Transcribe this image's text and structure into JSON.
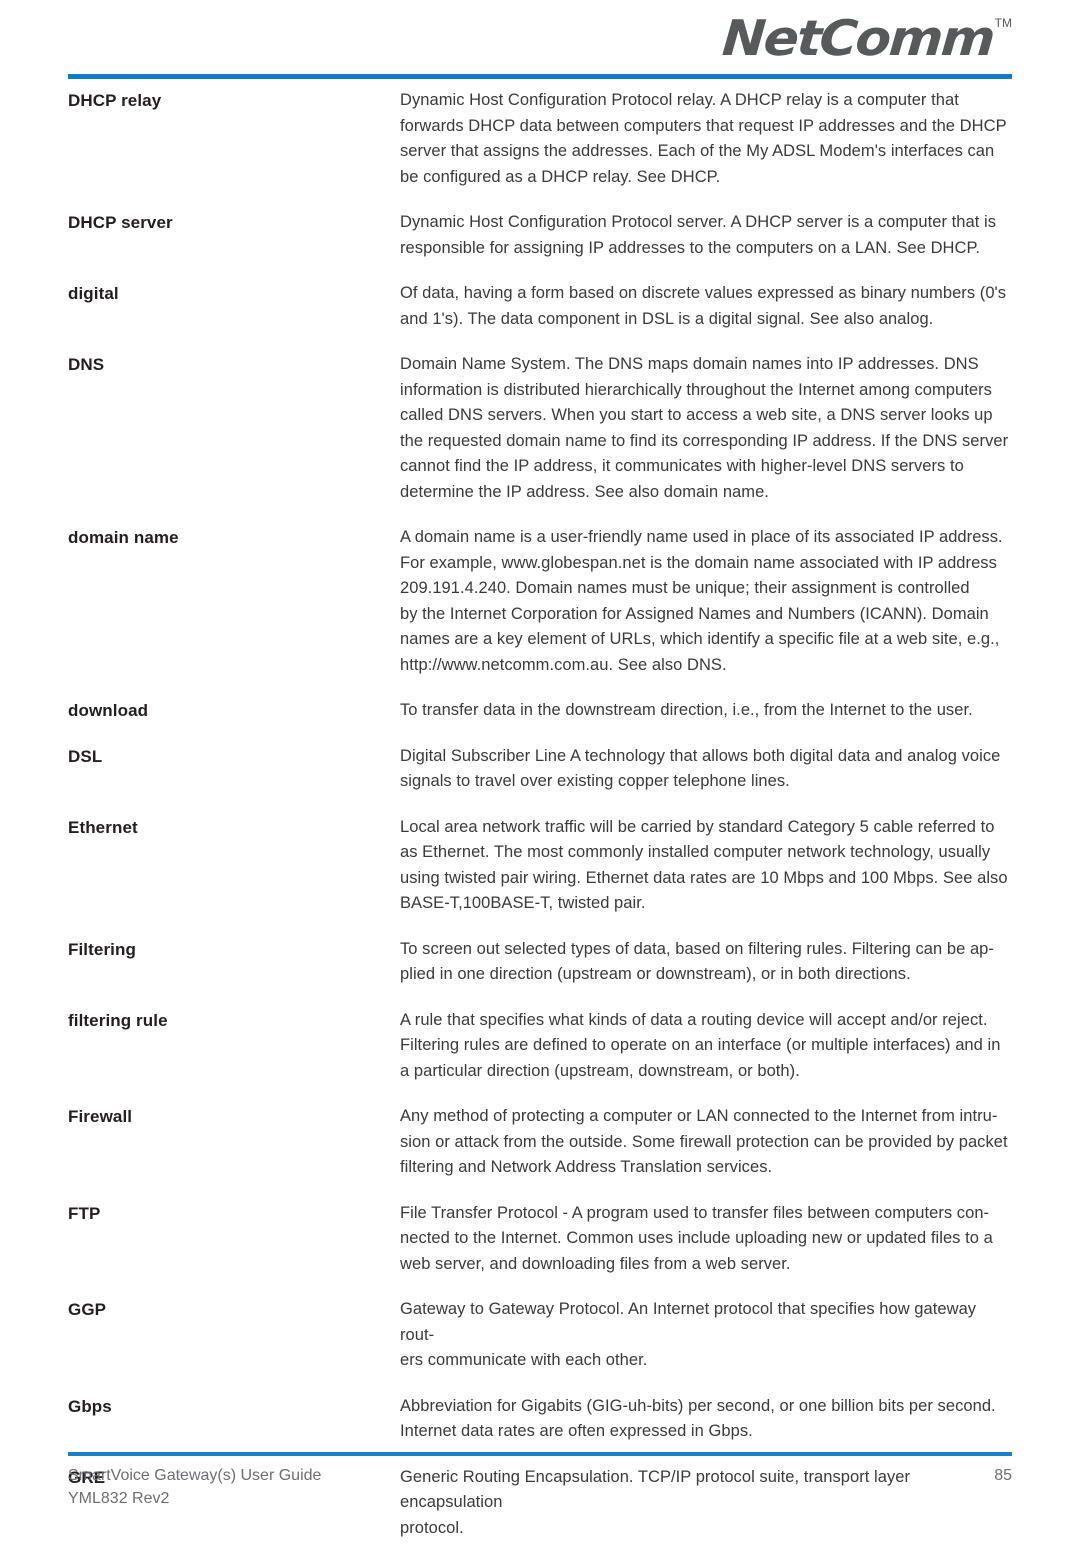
{
  "header": {
    "logo_text": "NetComm",
    "logo_trademark": "TM",
    "accent_color": "#0d7cc4"
  },
  "glossary": {
    "entries": [
      {
        "term": "DHCP relay",
        "definition": "Dynamic Host Configuration Protocol relay.  A DHCP relay is a computer that\nforwards DHCP data between computers that request IP addresses and the DHCP\nserver that assigns the addresses. Each of the My ADSL Modem's interfaces can\nbe configured as a DHCP relay. See DHCP."
      },
      {
        "term": "DHCP server",
        "definition": "Dynamic Host Configuration Protocol server. A DHCP server is a computer that is\nresponsible for assigning IP addresses to the computers on a LAN. See DHCP."
      },
      {
        "term": "digital",
        "definition": "Of data, having a form based on discrete values expressed as binary numbers (0's\nand 1's). The data component in DSL is a digital signal. See also analog."
      },
      {
        "term": "DNS",
        "definition": "Domain Name System.  The DNS maps domain names into IP addresses. DNS\ninformation is distributed hierarchically throughout the Internet among computers\ncalled DNS servers. When you start to access a web site, a DNS server looks up\nthe requested domain name to find its corresponding IP address. If the DNS server\ncannot find the IP address, it communicates with higher-level DNS servers to\ndetermine the IP address. See also domain name."
      },
      {
        "term": "domain name",
        "definition": "A domain name is a user-friendly name used in place of its associated IP address.\nFor example, www.globespan.net is the domain name associated with IP address\n209.191.4.240. Domain names must be unique; their assignment is controlled\nby the Internet Corporation for Assigned Names and Numbers (ICANN). Domain\nnames are a key element of URLs, which identify a specific file at a web site, e.g.,\nhttp://www.netcomm.com.au. See also DNS."
      },
      {
        "term": "download",
        "definition": "To transfer data in the downstream direction, i.e., from the Internet to the user."
      },
      {
        "term": "DSL",
        "definition": "Digital Subscriber Line A technology that allows both digital data and analog voice\nsignals to travel over existing copper telephone lines."
      },
      {
        "term": "Ethernet",
        "definition": "Local area network traffic will be carried by standard Category 5 cable referred to\nas Ethernet.  The most commonly installed computer network technology, usually\nusing twisted pair wiring. Ethernet data rates are 10 Mbps and 100 Mbps. See also\nBASE-T,100BASE-T, twisted pair."
      },
      {
        "term": "Filtering",
        "definition": "To screen out selected types of data, based on filtering rules. Filtering can be ap-\nplied in one direction (upstream or downstream), or in both directions."
      },
      {
        "term": "filtering rule",
        "definition": "A rule that specifies what kinds of data a routing device will accept and/or reject.\nFiltering rules are defined to operate on an interface (or multiple interfaces) and in\na particular direction (upstream, downstream, or both)."
      },
      {
        "term": "Firewall",
        "definition": "Any method of protecting a computer or LAN connected to the Internet from intru-\nsion or attack from the outside. Some firewall protection can be provided by packet\nfiltering and Network Address Translation services."
      },
      {
        "term": "FTP",
        "definition": "File Transfer Protocol - A program used to transfer files between computers con-\nnected to the Internet.  Common uses include uploading new or updated files to a\nweb server, and downloading files from a web server."
      },
      {
        "term": "GGP",
        "definition": "Gateway to Gateway Protocol. An Internet protocol that specifies how gateway rout-\ners communicate with each other."
      },
      {
        "term": "Gbps",
        "definition": "Abbreviation for Gigabits (GIG-uh-bits) per second, or one billion bits per second.\nInternet data rates are often expressed in Gbps."
      },
      {
        "term": "GRE",
        "definition": "Generic Routing Encapsulation. TCP/IP protocol suite, transport layer encapsulation\nprotocol."
      }
    ]
  },
  "footer": {
    "document_title": "SmartVoice Gateway(s) User Guide",
    "document_revision": "YML832 Rev2",
    "page_number": "85"
  }
}
